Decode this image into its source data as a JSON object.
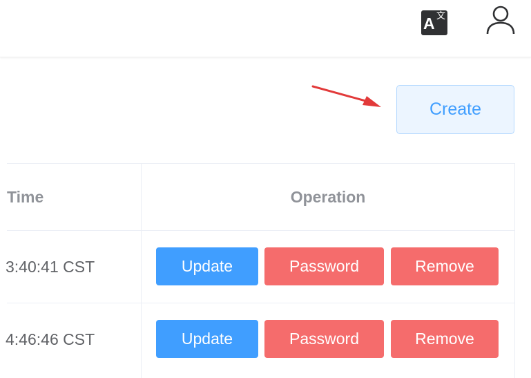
{
  "header": {
    "translate_icon": "translate-icon",
    "translate_glyph_main": "A",
    "translate_glyph_sub": "文",
    "user_icon": "user-icon"
  },
  "toolbar": {
    "create_label": "Create"
  },
  "table": {
    "columns": {
      "time": "Time",
      "operation": "Operation"
    },
    "rows": [
      {
        "time": "3:40:41 CST",
        "update_label": "Update",
        "password_label": "Password",
        "remove_label": "Remove"
      },
      {
        "time": "4:46:46 CST",
        "update_label": "Update",
        "password_label": "Password",
        "remove_label": "Remove"
      }
    ]
  },
  "colors": {
    "primary": "#409eff",
    "danger": "#f56c6c",
    "create_bg": "#ecf5ff",
    "header_text": "#909399",
    "annotation_arrow": "#e23a3a"
  }
}
